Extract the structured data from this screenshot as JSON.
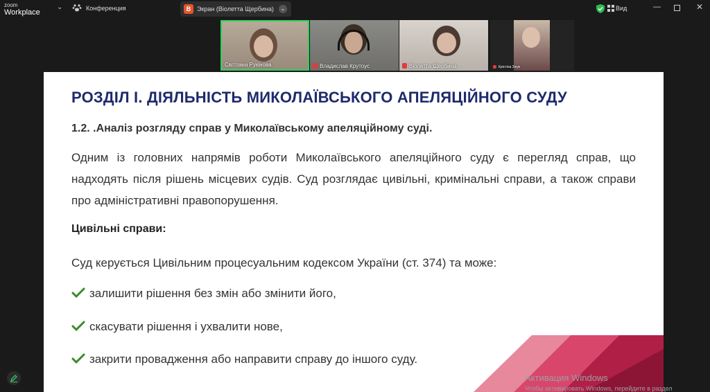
{
  "app": {
    "logo_small": "zoom",
    "logo_big": "Workplace",
    "conference_label": "Конференция"
  },
  "share": {
    "avatar_letter": "В",
    "label": "Экран (Віолетта Щербина)"
  },
  "window": {
    "view_label": "Вид"
  },
  "participants": [
    {
      "name": "Світлана Рукінова"
    },
    {
      "name": "Владислав Крутоус"
    },
    {
      "name": "Віолетта Щербина"
    },
    {
      "name": "Крістіна Зінук"
    }
  ],
  "slide": {
    "title": "РОЗДІЛ І. ДІЯЛЬНІСТЬ МИКОЛАЇВСЬКОГО АПЕЛЯЦІЙНОГО СУДУ",
    "subtitle": "1.2. .Аналіз розгляду справ у Миколаївському апеляційному суді.",
    "paragraph": "Одним із головних напрямів роботи Миколаївського апеляційного суду є перегляд справ, що надходять після рішень місцевих судів. Суд розглядає цивільні, кримінальні справи, а також справи про адміністративні правопорушення.",
    "civil_heading": "Цивільні справи:",
    "rule_text": "Суд керується Цивільним процесуальним кодексом України (ст. 374) та може:",
    "bullets": [
      "залишити рішення без змін або змінити його,",
      "скасувати рішення і ухвалити нове,",
      "закрити провадження або направити справу до іншого суду."
    ]
  },
  "watermark": {
    "line1": "Активация Windows",
    "line2": "Чтобы активировать Windows, перейдите в раздел"
  },
  "colors": {
    "title_blue": "#1f2a6b",
    "active_speaker": "#2dd35a",
    "check_green": "#3a8a2a",
    "deco_pink": "#e0607e",
    "deco_crimson": "#b01f45"
  }
}
